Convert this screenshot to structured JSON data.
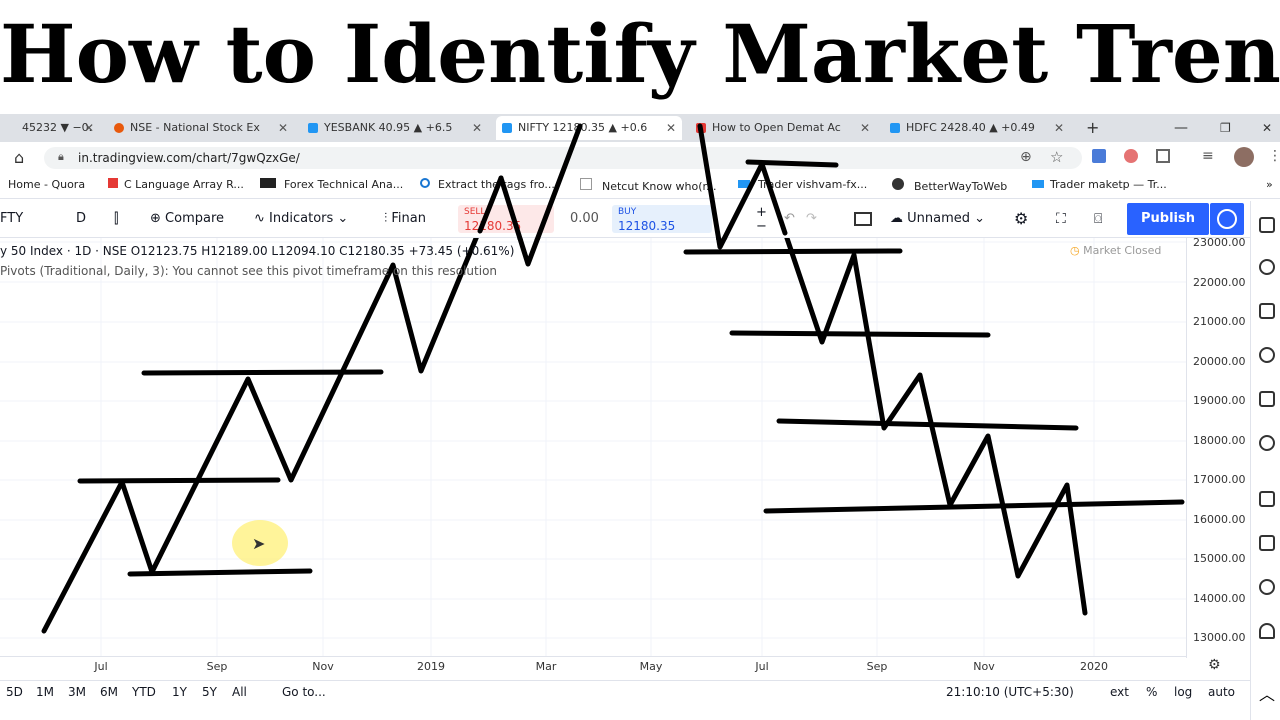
{
  "headline": "How to Identify Market Trend",
  "browser": {
    "tabs": [
      {
        "label": "45232 ▼ −0.",
        "icon_color": "#888"
      },
      {
        "label": "NSE - National Stock Ex",
        "icon_color": "#e8590c"
      },
      {
        "label": "YESBANK 40.95 ▲ +6.5",
        "icon_color": "#2196f3"
      },
      {
        "label": "NIFTY 12180.35 ▲ +0.6",
        "icon_color": "#2196f3",
        "active": true
      },
      {
        "label": "How to Open Demat Ac",
        "icon_color": "#e53935"
      },
      {
        "label": "HDFC 2428.40 ▲ +0.49",
        "icon_color": "#2196f3"
      }
    ],
    "new_tab": "+",
    "url": "in.tradingview.com/chart/7gwQzxGe/",
    "bookmarks": [
      "Home - Quora",
      "C Language Array R...",
      "Forex Technical Ana...",
      "Extract the tags fro...",
      "Netcut Know who(r...",
      "Trader vishvam-fx...",
      "BetterWayToWeb",
      "Trader maketp — Tr..."
    ]
  },
  "toolbar": {
    "symbol": "FTY",
    "interval": "D",
    "compare": "Compare",
    "indicators": "Indicators",
    "financials": "Finan",
    "sell_label": "SELL",
    "sell_value": "12180.35",
    "spread": "0.00",
    "buy_label": "BUY",
    "buy_value": "12180.35",
    "layout_name": "Unnamed",
    "publish": "Publish"
  },
  "legend": {
    "line1": "y 50 Index · 1D · NSE  O12123.75  H12189.00  L12094.10  C12180.35  +73.45 (+0.61%)",
    "line2": "Pivots (Traditional, Daily, 3): You cannot see this pivot timeframe on this resolution",
    "market_status": "Market Closed"
  },
  "price_scale": [
    "23000.00",
    "22000.00",
    "21000.00",
    "20000.00",
    "19000.00",
    "18000.00",
    "17000.00",
    "16000.00",
    "15000.00",
    "14000.00",
    "13000.00"
  ],
  "time_axis": [
    "Jul",
    "Sep",
    "Nov",
    "2019",
    "Mar",
    "May",
    "Jul",
    "Sep",
    "Nov",
    "2020"
  ],
  "bottom_bar": {
    "ranges": [
      "5D",
      "1M",
      "3M",
      "6M",
      "YTD",
      "1Y",
      "5Y",
      "All"
    ],
    "goto": "Go to...",
    "clock": "21:10:10 (UTC+5:30)",
    "ext": "ext",
    "percent": "%",
    "log": "log",
    "auto": "auto"
  },
  "colors": {
    "accent": "#2962ff",
    "ink": "#000000"
  }
}
